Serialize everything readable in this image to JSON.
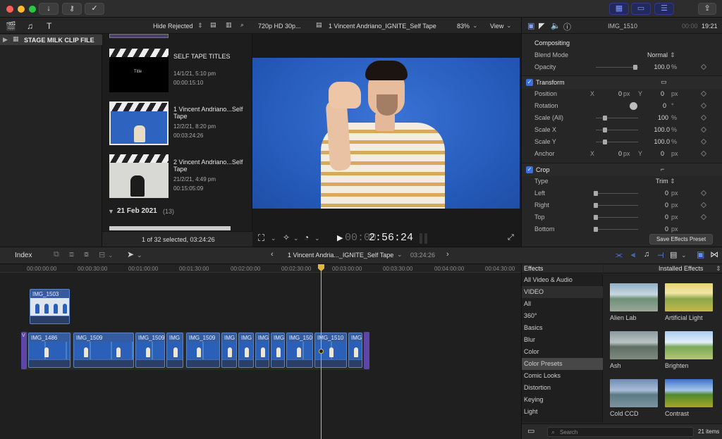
{
  "toolbar": {
    "import_icon": "download-arrow-icon",
    "keywords_icon": "key-icon",
    "analyze_icon": "checkmark-icon",
    "share_icon": "share-icon"
  },
  "library": {
    "event_label": "STAGE MILK CLIP FILE"
  },
  "browser": {
    "filter": "Hide Rejected",
    "clips": [
      {
        "title": "SELF TAPE TITLES",
        "date": "14/1/21, 5:10 pm",
        "duration": "00:00:15:10"
      },
      {
        "title": "1 Vincent Andriano...Self Tape",
        "date": "12/2/21, 8:20 pm",
        "duration": "00:03:24:26"
      },
      {
        "title": "2 Vincent Andriano...Self Tape",
        "date": "21/2/21, 4:49 pm",
        "duration": "00:15:05:09"
      }
    ],
    "group_date": "21 Feb 2021",
    "group_count": "(13)",
    "status": "1 of 32 selected, 03:24:26",
    "title_card_text": "Title"
  },
  "viewer": {
    "format": "720p HD 30p...",
    "project": "1 Vincent Andriano_IGNITE_Self Tape",
    "zoom": "83%",
    "view": "View",
    "timecode_dim": "00:00",
    "timecode": "2:56:24"
  },
  "inspector": {
    "clip_name": "IMG_1510",
    "duration_dim": "00:00",
    "duration": "19:21",
    "compositing": "Compositing",
    "blend_mode_label": "Blend Mode",
    "blend_mode": "Normal",
    "opacity_label": "Opacity",
    "opacity": "100.0",
    "opacity_unit": "%",
    "transform": "Transform",
    "position_label": "Position",
    "rotation_label": "Rotation",
    "scale_all_label": "Scale (All)",
    "scale_x_label": "Scale X",
    "scale_y_label": "Scale Y",
    "anchor_label": "Anchor",
    "x": "X",
    "y": "Y",
    "zero": "0",
    "px": "px",
    "deg": "°",
    "pct": "%",
    "hundred": "100",
    "hundred_dec": "100.0",
    "crop": "Crop",
    "type_label": "Type",
    "type": "Trim",
    "left_label": "Left",
    "right_label": "Right",
    "top_label": "Top",
    "bottom_label": "Bottom",
    "save_preset": "Save Effects Preset"
  },
  "timeline_bar": {
    "index": "Index",
    "project": "1 Vincent Andria..._IGNITE_Self Tape",
    "duration": "03:24:26"
  },
  "ruler": [
    "00:00:00:00",
    "00:00:30:00",
    "00:01:00:00",
    "00:01:30:00",
    "00:02:00:00",
    "00:02:30:00",
    "00:03:00:00",
    "00:03:30:00",
    "00:04:00:00",
    "00:04:30:00"
  ],
  "timeline": {
    "connected_clip": "IMG_1503",
    "clips": [
      "IMG_1486",
      "IMG_1509",
      "IMG_1509",
      "IMG_1509",
      "IMG_1509",
      "IMG_1510"
    ],
    "short_labels": "IMG",
    "track_label": "V"
  },
  "effects": {
    "title": "Effects",
    "installed": "Installed Effects",
    "categories": [
      "All Video & Audio",
      "VIDEO",
      "All",
      "360°",
      "Basics",
      "Blur",
      "Color",
      "Color Presets",
      "Comic Looks",
      "Distortion",
      "Keying",
      "Light"
    ],
    "selected_category": "Color Presets",
    "items": [
      "Alien Lab",
      "Artificial Light",
      "Ash",
      "Brighten",
      "Cold CCD",
      "Contrast"
    ],
    "search_placeholder": "Search",
    "count": "21 items"
  }
}
